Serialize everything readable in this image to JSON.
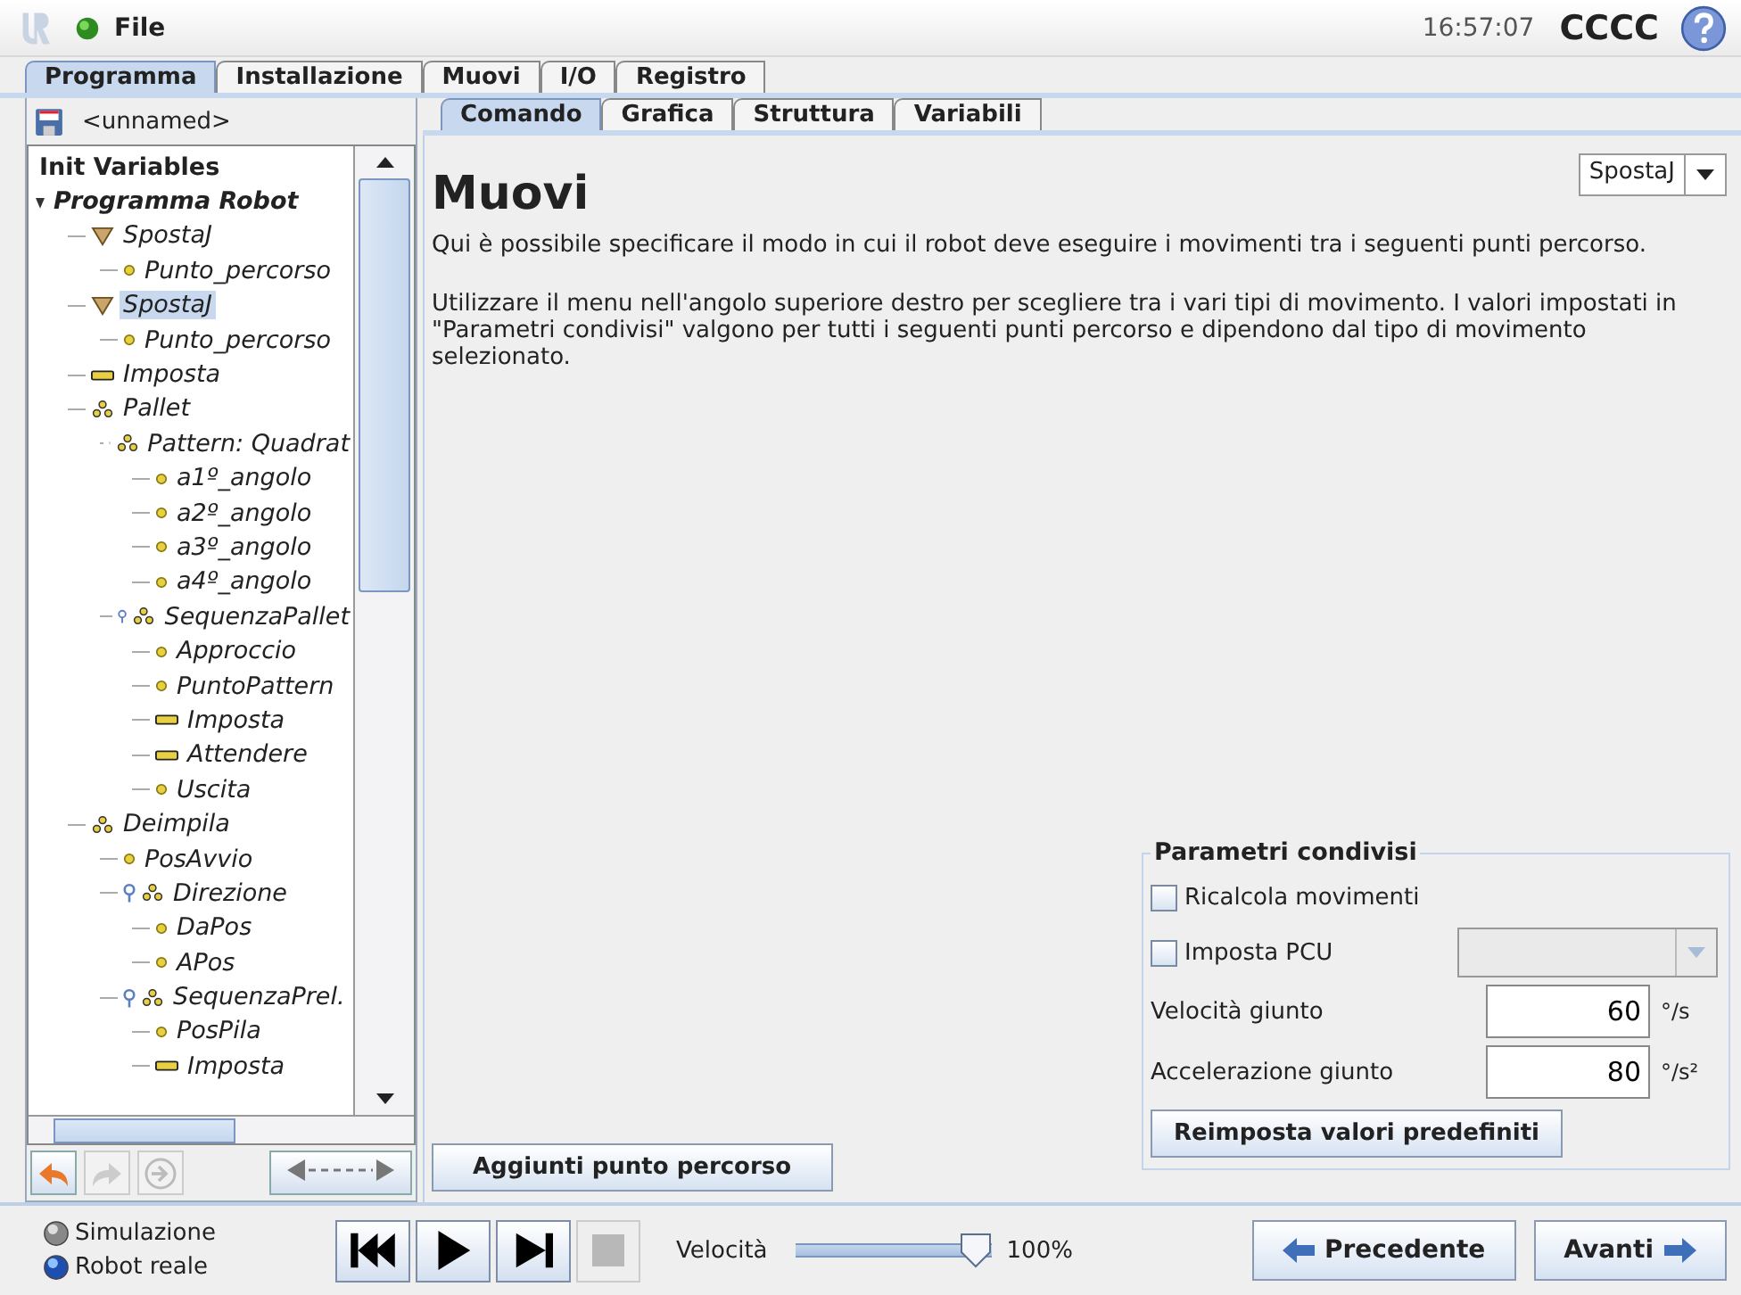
{
  "header": {
    "menu": "File",
    "time": "16:57:07",
    "robot_name": "CCCC"
  },
  "main_tabs": [
    {
      "label": "Programma",
      "selected": true
    },
    {
      "label": "Installazione",
      "selected": false
    },
    {
      "label": "Muovi",
      "selected": false
    },
    {
      "label": "I/O",
      "selected": false
    },
    {
      "label": "Registro",
      "selected": false
    }
  ],
  "program_file": "<unnamed>",
  "tree": [
    {
      "kind": "label",
      "label": "Init Variables",
      "selected": false
    },
    {
      "kind": "program",
      "label": "Programma Robot",
      "selected": false,
      "children": [
        {
          "kind": "move",
          "label": "SpostaJ",
          "selected": false,
          "children": [
            {
              "kind": "waypoint",
              "label": "Punto_percorso",
              "selected": false
            }
          ]
        },
        {
          "kind": "move",
          "label": "SpostaJ",
          "selected": true,
          "children": [
            {
              "kind": "waypoint",
              "label": "Punto_percorso",
              "selected": false
            }
          ]
        },
        {
          "kind": "set",
          "label": "Imposta",
          "selected": false
        },
        {
          "kind": "pallet",
          "label": "Pallet",
          "selected": false,
          "children": [
            {
              "kind": "pallet",
              "label": "Pattern: Quadrat",
              "selected": false,
              "children": [
                {
                  "kind": "waypoint",
                  "label": "a1º_angolo",
                  "selected": false
                },
                {
                  "kind": "waypoint",
                  "label": "a2º_angolo",
                  "selected": false
                },
                {
                  "kind": "waypoint",
                  "label": "a3º_angolo",
                  "selected": false
                },
                {
                  "kind": "waypoint",
                  "label": "a4º_angolo",
                  "selected": false
                }
              ]
            },
            {
              "kind": "pallet",
              "label": "SequenzaPallet",
              "selected": false,
              "children": [
                {
                  "kind": "waypoint",
                  "label": "Approccio",
                  "selected": false
                },
                {
                  "kind": "waypoint",
                  "label": "PuntoPattern",
                  "selected": false
                },
                {
                  "kind": "set",
                  "label": "Imposta",
                  "selected": false
                },
                {
                  "kind": "set",
                  "label": "Attendere",
                  "selected": false
                },
                {
                  "kind": "waypoint",
                  "label": "Uscita",
                  "selected": false
                }
              ]
            }
          ]
        },
        {
          "kind": "pallet",
          "label": "Deimpila",
          "selected": false,
          "children": [
            {
              "kind": "waypoint",
              "label": "PosAvvio",
              "selected": false
            },
            {
              "kind": "pallet",
              "label": "Direzione",
              "selected": false,
              "children": [
                {
                  "kind": "waypoint",
                  "label": "DaPos",
                  "selected": false
                },
                {
                  "kind": "waypoint",
                  "label": "APos",
                  "selected": false
                }
              ]
            },
            {
              "kind": "pallet",
              "label": "SequenzaPrel.",
              "selected": false,
              "children": [
                {
                  "kind": "waypoint",
                  "label": "PosPila",
                  "selected": false
                },
                {
                  "kind": "set",
                  "label": "Imposta",
                  "selected": false
                }
              ]
            }
          ]
        }
      ]
    }
  ],
  "sub_tabs": [
    {
      "label": "Comando",
      "selected": true
    },
    {
      "label": "Grafica",
      "selected": false
    },
    {
      "label": "Struttura",
      "selected": false
    },
    {
      "label": "Variabili",
      "selected": false
    }
  ],
  "content": {
    "title": "Muovi",
    "move_type": "SpostaJ",
    "paragraphs": [
      "Qui è possibile specificare il modo in cui il robot deve eseguire i movimenti tra i seguenti punti percorso.",
      "Utilizzare il menu nell'angolo superiore destro per scegliere tra i vari tipi di movimento. I valori impostati in \"Parametri condivisi\" valgono per tutti i seguenti punti percorso e dipendono dal tipo di movimento selezionato."
    ]
  },
  "shared_params": {
    "title": "Parametri condivisi",
    "checkboxes": [
      {
        "label": "Ricalcola movimenti",
        "checked": false
      },
      {
        "label": "Imposta PCU",
        "checked": false,
        "dropdown": {
          "disabled": true
        }
      }
    ],
    "fields": [
      {
        "label": "Velocità giunto",
        "value": "60",
        "unit": "°/s"
      },
      {
        "label": "Accelerazione giunto",
        "value": "80",
        "unit": "°/s²"
      }
    ],
    "reset_button": "Reimposta valori predefiniti"
  },
  "add_waypoint_button": "Aggiunti punto percorso",
  "modes": [
    {
      "label": "Simulazione",
      "selected": false
    },
    {
      "label": "Robot reale",
      "selected": true
    }
  ],
  "speed": {
    "label": "Velocità",
    "level": 1,
    "reading": "100%"
  },
  "nav": {
    "previous": "Precedente",
    "next": "Avanti"
  }
}
